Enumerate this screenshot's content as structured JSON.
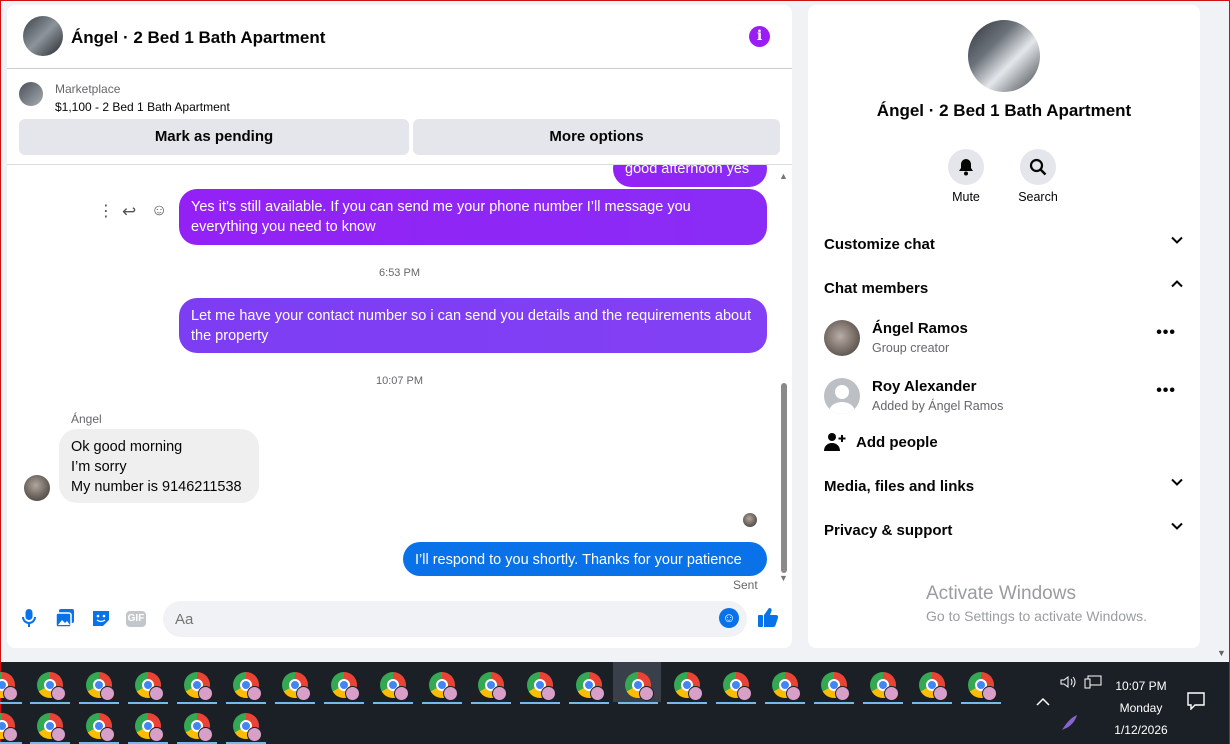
{
  "chat": {
    "title": "Ángel · 2 Bed 1 Bath Apartment",
    "marketplace_label": "Marketplace",
    "marketplace_item": "$1,100 - 2 Bed 1 Bath Apartment",
    "mark_pending_label": "Mark as pending",
    "more_options_label": "More options",
    "messages": {
      "partial_top": "good afternoon yes",
      "available": "Yes it’s still available. If you can send me your phone number I’ll message you everything you need to know",
      "time1": "6:53 PM",
      "contact": "Let me have your contact number so i can send you details and the requirements about the property",
      "time2": "10:07 PM",
      "sender_name": "Ángel",
      "reply_line1": "Ok good morning",
      "reply_line2": "I’m sorry",
      "reply_line3": "My number is 9146211538",
      "respond": "I’ll respond to you shortly. Thanks for your patience",
      "sent_status": "Sent"
    },
    "composer_placeholder": "Aa",
    "gif_label": "GIF"
  },
  "details": {
    "title": "Ángel · 2 Bed 1 Bath Apartment",
    "mute_label": "Mute",
    "search_label": "Search",
    "customize_chat": "Customize chat",
    "chat_members": "Chat members",
    "members": [
      {
        "name": "Ángel Ramos",
        "role": "Group creator"
      },
      {
        "name": "Roy Alexander",
        "role": "Added by Ángel Ramos"
      }
    ],
    "add_people": "Add people",
    "media_files_links": "Media, files and links",
    "privacy_support": "Privacy & support"
  },
  "watermark": {
    "title": "Activate Windows",
    "subtitle": "Go to Settings to activate Windows."
  },
  "taskbar": {
    "time": "10:07 PM",
    "day": "Monday",
    "date": "1/12/2026"
  },
  "colors": {
    "messenger_purple": "#9321f5",
    "messenger_blue": "#0a72e8",
    "taskbar_bg": "#1b2027"
  }
}
